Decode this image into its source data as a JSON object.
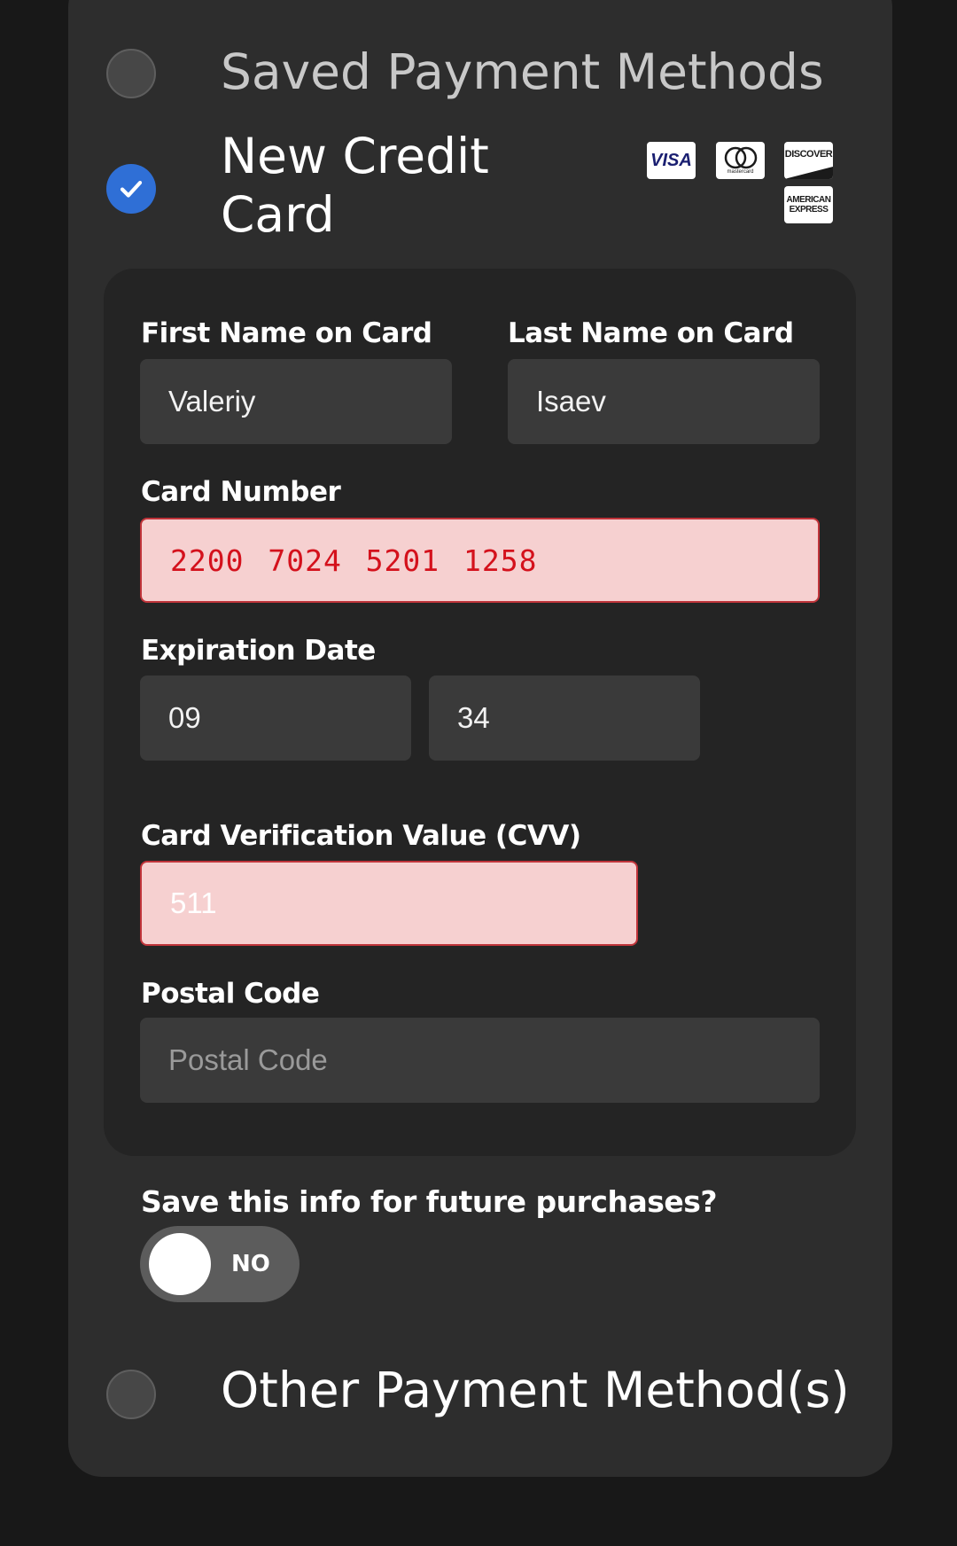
{
  "payment_options": {
    "saved": {
      "label": "Saved Payment Methods",
      "selected": false
    },
    "new_card": {
      "label_line1": "New Credit",
      "label_line2": "Card",
      "selected": true
    },
    "other": {
      "label": "Other Payment Method(s)",
      "selected": false
    }
  },
  "card_brands": {
    "visa": "VISA",
    "mastercard": "mastercard",
    "discover": "DISCOVER",
    "amex_line1": "AMERICAN",
    "amex_line2": "EXPRESS"
  },
  "form": {
    "first_name": {
      "label": "First Name on Card",
      "value": "Valeriy"
    },
    "last_name": {
      "label": "Last Name on Card",
      "value": "Isaev"
    },
    "card_number": {
      "label": "Card Number",
      "value": "2200 7024 5201 1258",
      "error": true
    },
    "expiration": {
      "label": "Expiration Date",
      "month": "09",
      "year": "34"
    },
    "cvv": {
      "label": "Card Verification Value (CVV)",
      "value": "511",
      "error": true
    },
    "postal_code": {
      "label": "Postal Code",
      "placeholder": "Postal Code",
      "value": ""
    }
  },
  "save_info": {
    "label": "Save this info for future purchases?",
    "toggle_text": "NO",
    "on": false
  },
  "colors": {
    "accent": "#2f6fd6",
    "error_bg": "#f6d0d0",
    "error_border": "#c0343a",
    "error_text": "#d4111c"
  }
}
